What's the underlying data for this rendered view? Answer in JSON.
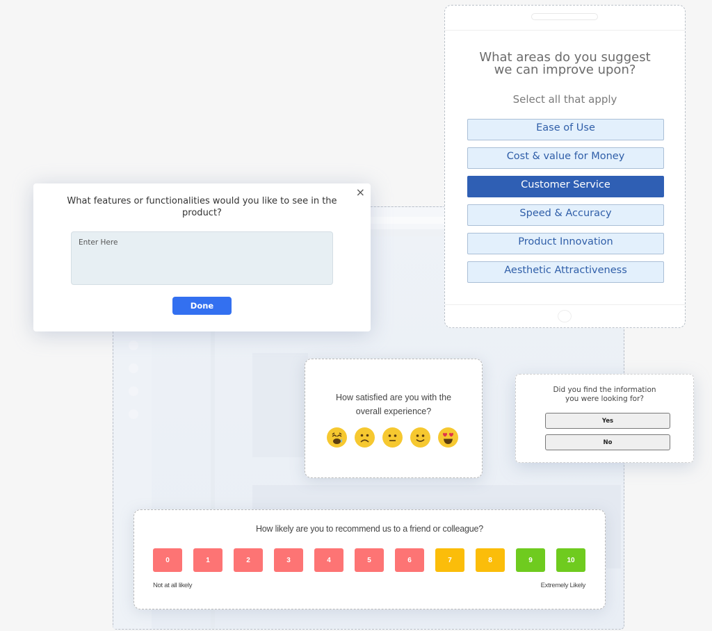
{
  "improvement_survey": {
    "title_line1": "What areas do you suggest",
    "title_line2": "we can improve upon?",
    "subtitle": "Select all that apply",
    "options": [
      {
        "label": "Ease of Use",
        "selected": false
      },
      {
        "label": "Cost & value for Money",
        "selected": false
      },
      {
        "label": "Customer Service",
        "selected": true
      },
      {
        "label": "Speed & Accuracy",
        "selected": false
      },
      {
        "label": "Product Innovation",
        "selected": false
      },
      {
        "label": "Aesthetic Attractiveness",
        "selected": false
      }
    ]
  },
  "feature_modal": {
    "question": "What features or functionalities would you like to see in the product?",
    "textarea_placeholder": "Enter Here",
    "textarea_value": "",
    "done_label": "Done",
    "close_icon": "×"
  },
  "satisfaction_survey": {
    "question_line1": "How satisfied are you with the",
    "question_line2": "overall experience?",
    "emojis": [
      {
        "name": "crying-face",
        "rating": 1
      },
      {
        "name": "frowning-face",
        "rating": 2
      },
      {
        "name": "neutral-face",
        "rating": 3
      },
      {
        "name": "slightly-smiling-face",
        "rating": 4
      },
      {
        "name": "heart-eyes-face",
        "rating": 5
      }
    ]
  },
  "info_survey": {
    "question_line1": "Did you find the information",
    "question_line2": "you were looking for?",
    "yes_label": "Yes",
    "no_label": "No"
  },
  "nps_survey": {
    "question": "How likely are you to recommend us to a friend or colleague?",
    "scores": [
      "0",
      "1",
      "2",
      "3",
      "4",
      "5",
      "6",
      "7",
      "8",
      "9",
      "10"
    ],
    "score_colors": [
      "#fd7474",
      "#fd7474",
      "#fd7474",
      "#fd7474",
      "#fd7474",
      "#fd7474",
      "#fd7474",
      "#fbbd0a",
      "#fbbd0a",
      "#6fcb1f",
      "#6fcb1f"
    ],
    "low_label": "Not at all likely",
    "high_label": "Extremely Likely"
  },
  "colors": {
    "selected_option": "#2f5fb4",
    "option_bg": "#e3f0fc",
    "done_button": "#3370f0",
    "detractor": "#fd7474",
    "passive": "#fbbd0a",
    "promoter": "#6fcb1f"
  }
}
